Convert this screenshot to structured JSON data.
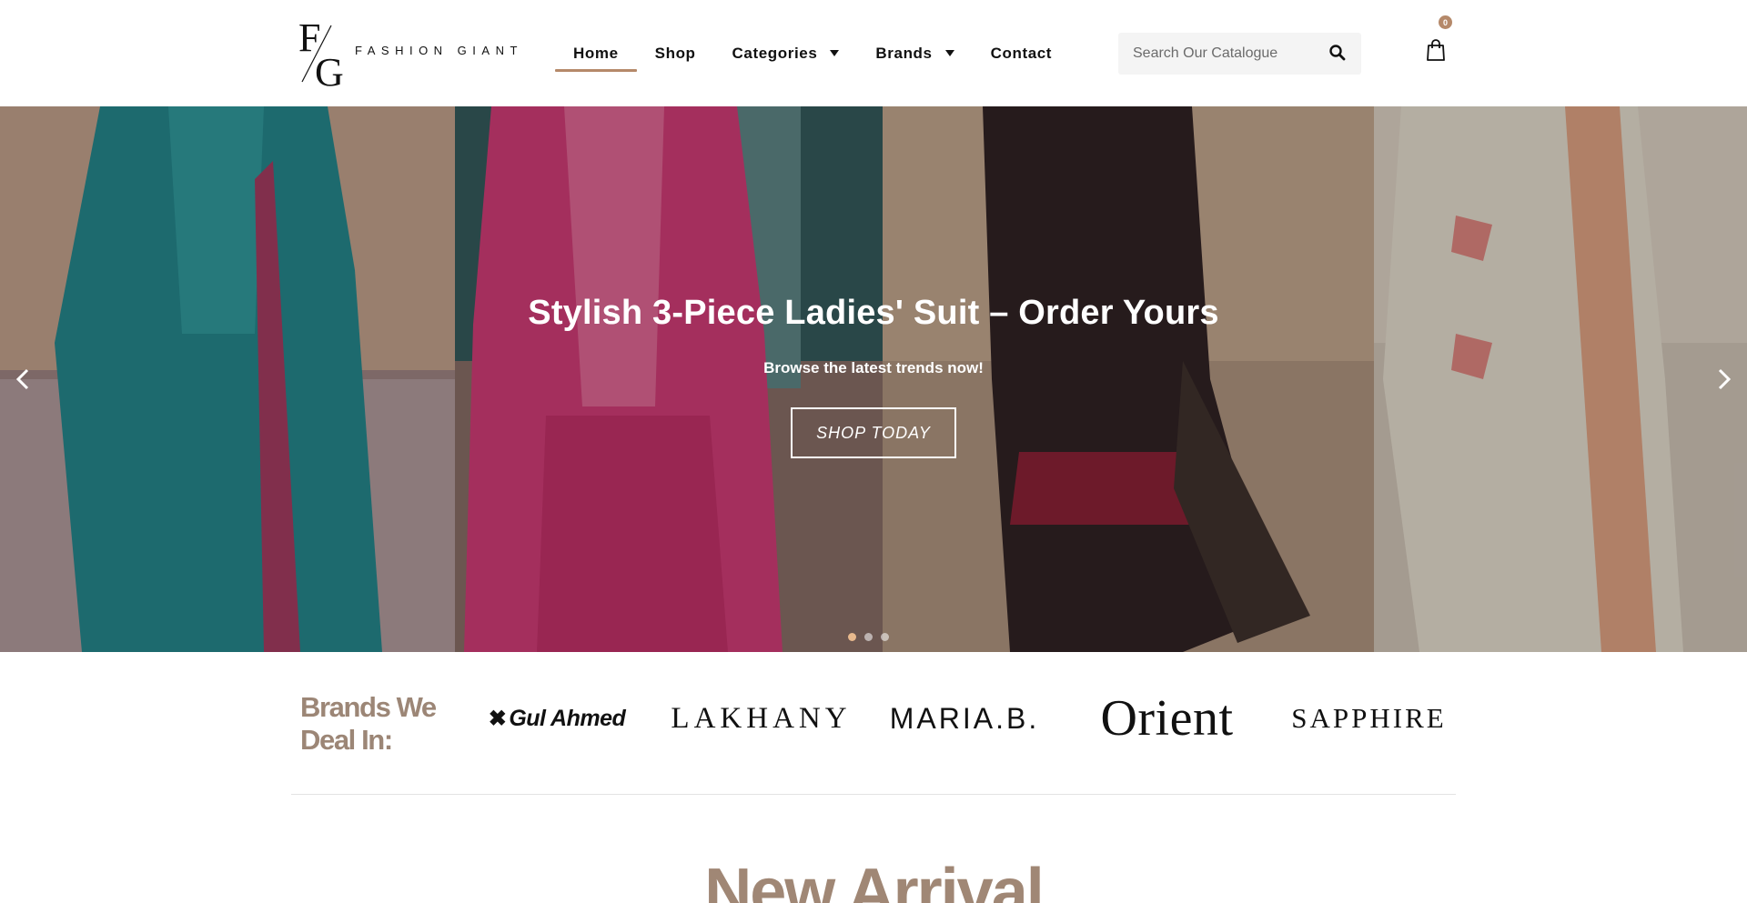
{
  "brand": {
    "logo_text": "FASHION GIANT",
    "accent_color": "#b5896a"
  },
  "nav": {
    "items": [
      {
        "label": "Home",
        "active": true
      },
      {
        "label": "Shop"
      },
      {
        "label": "Categories",
        "dropdown": true
      },
      {
        "label": "Brands",
        "dropdown": true
      },
      {
        "label": "Contact"
      }
    ]
  },
  "search": {
    "placeholder": "Search Our Catalogue",
    "icon": "search-icon"
  },
  "cart": {
    "icon": "shopping-bag-icon",
    "count": "0"
  },
  "hero": {
    "title": "Stylish 3-Piece Ladies' Suit – Order Yours",
    "subtitle": "Browse the latest trends now!",
    "cta_label": "SHOP TODAY",
    "prev_icon": "chevron-left-icon",
    "next_icon": "chevron-right-icon",
    "slides_count": 3,
    "active_slide": 1
  },
  "brands_section": {
    "title": "Brands We Deal In:",
    "logos": [
      "Gul Ahmed",
      "LAKHANY",
      "MARIA.B.",
      "Orient",
      "SAPPHIRE"
    ]
  },
  "new_arrival": {
    "title": "New Arrival"
  }
}
